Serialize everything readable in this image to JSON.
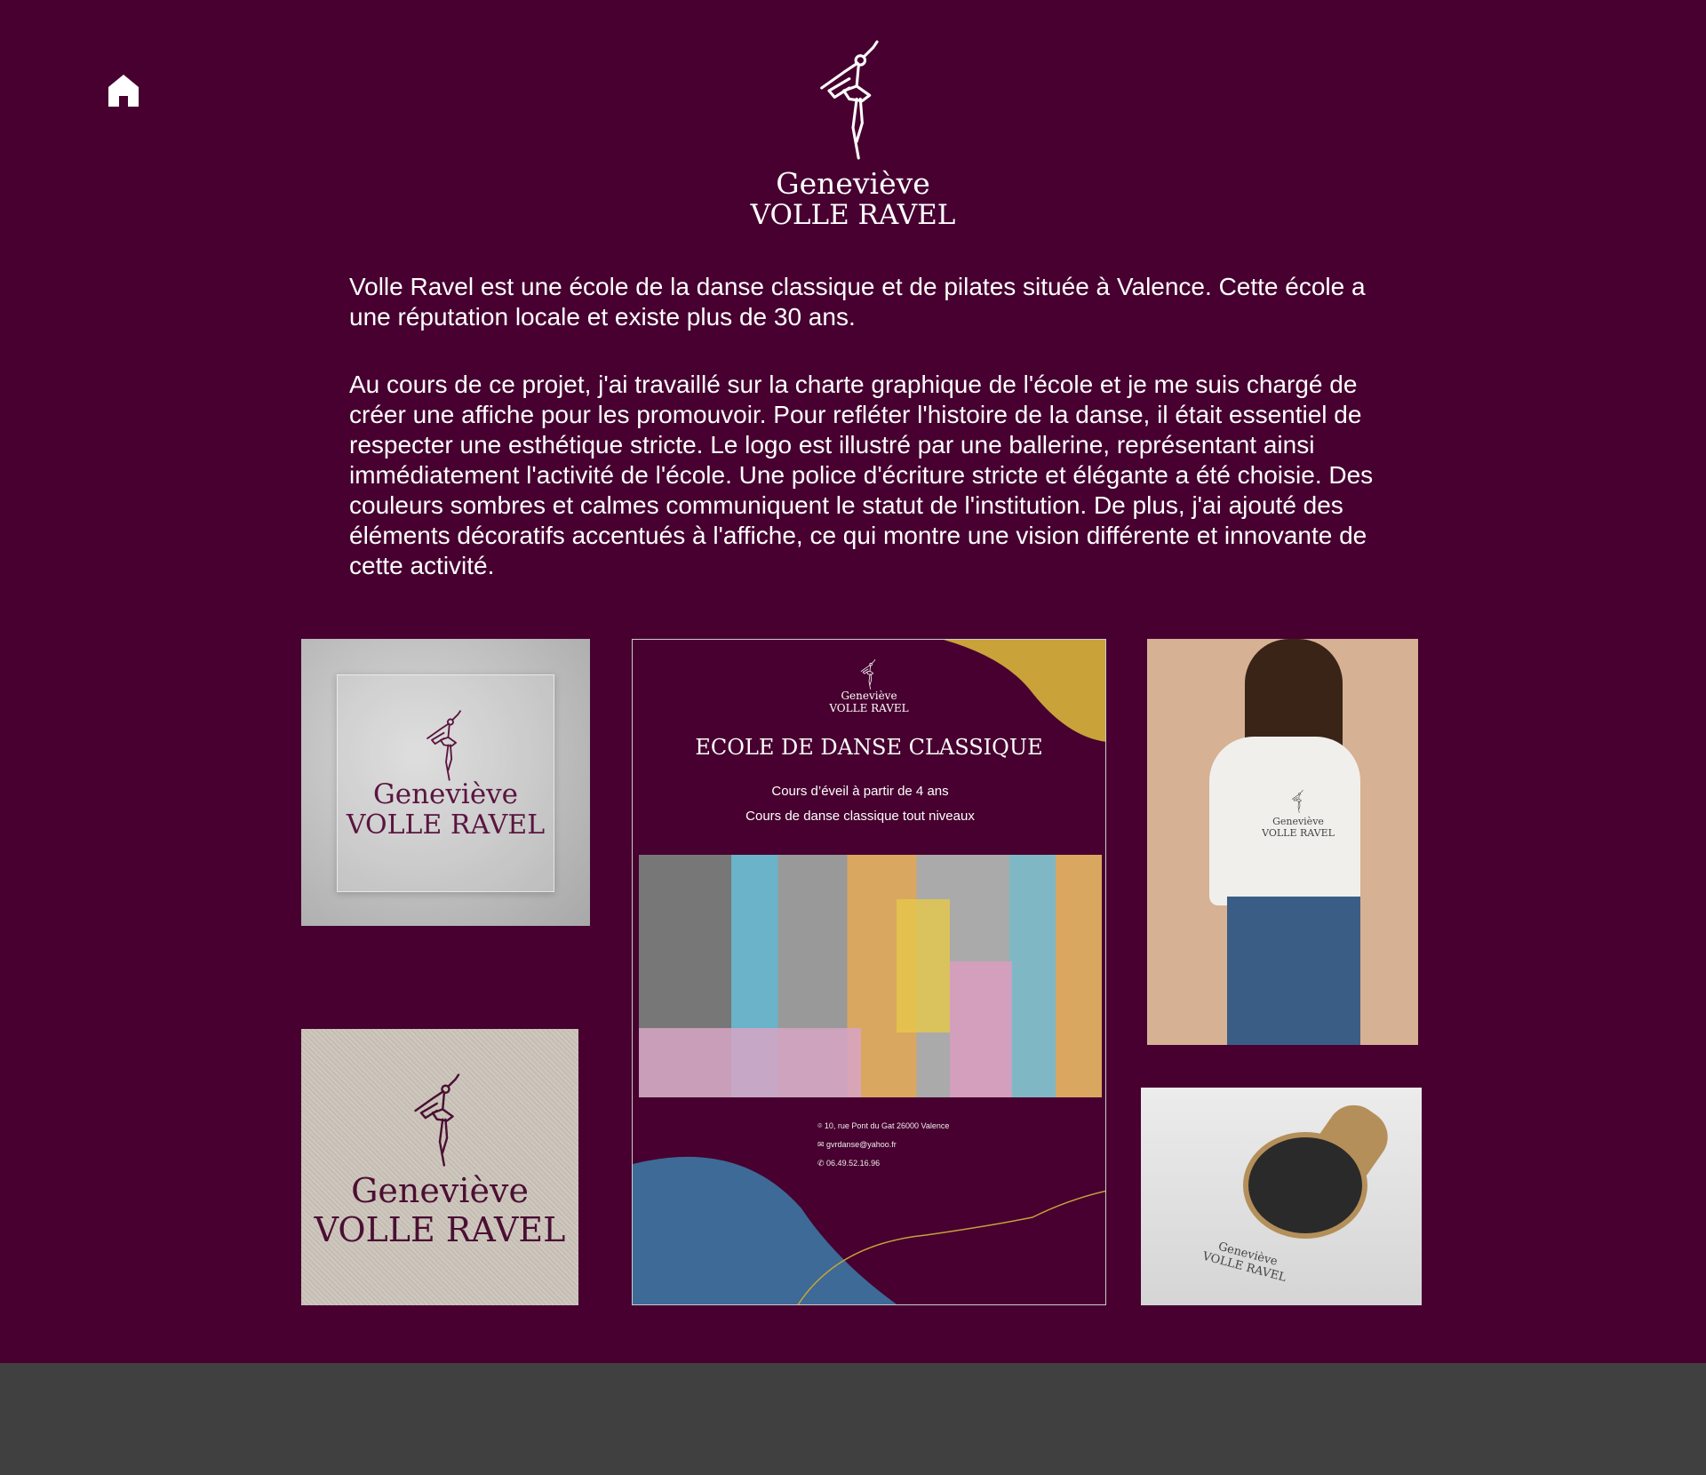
{
  "nav": {
    "home_icon": "home-icon"
  },
  "logo": {
    "first_name": "Geneviève",
    "last_name": "VOLLE RAVEL"
  },
  "intro": {
    "p1": "Volle Ravel est une école de la danse classique et de pilates située à Valence. Cette école a une réputation locale et existe plus de 30 ans.",
    "p2": "Au cours de ce projet, j'ai travaillé sur la charte graphique de l'école et je me suis chargé de créer une affiche pour les promouvoir. Pour refléter l'histoire de la danse, il était essentiel de respecter une esthétique stricte. Le logo est illustré par une ballerine, représentant ainsi immédiatement l'activité de l'école. Une police d'écriture stricte et élégante a été choisie. Des couleurs sombres et calmes communiquent le statut de l'institution. De plus, j'ai ajouté des éléments décoratifs accentués à l'affiche, ce qui montre une vision différente et innovante de cette activité."
  },
  "poster": {
    "title": "ECOLE DE DANSE CLASSIQUE",
    "line1": "Cours d’éveil à partir de 4 ans",
    "line2": "Cours de danse classique tout niveaux",
    "address": "10, rue Pont du Gat 26000 Valence",
    "email": "gvrdanse@yahoo.fr",
    "phone": "06.49.52.16.96"
  },
  "colors": {
    "background": "#470030",
    "gold": "#c9a23a",
    "blue": "#3d6a96",
    "footer": "#404040"
  }
}
